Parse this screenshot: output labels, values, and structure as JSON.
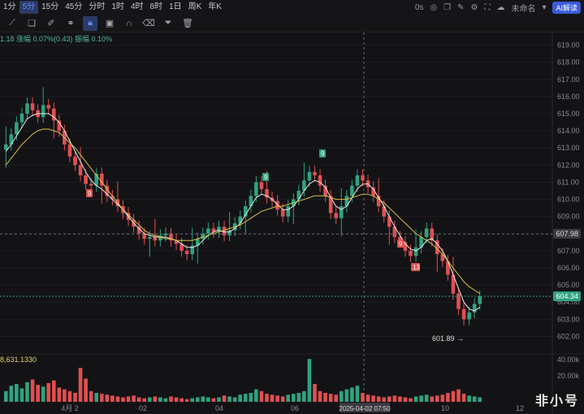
{
  "timeframes": [
    "1分",
    "5分",
    "15分",
    "45分",
    "分时",
    "1时",
    "4时",
    "8时",
    "1日",
    "周K",
    "年K"
  ],
  "active_timeframe": "5分",
  "top_right": {
    "countdown": "0s",
    "layout_name": "未命名",
    "ai_button": "AI解读"
  },
  "legend": {
    "ma_text": "1.18  涨幅 0.07%(0.43)  振幅 0.10%",
    "volume_text": "8,631.1330"
  },
  "price_axis": [
    "619.00",
    "618.00",
    "617.00",
    "616.00",
    "615.00",
    "614.00",
    "613.00",
    "612.00",
    "611.00",
    "610.00",
    "609.00",
    "608.00",
    "607.00",
    "606.00",
    "605.00",
    "604.00",
    "603.00",
    "602.00"
  ],
  "volume_axis": [
    "40.00k",
    "20.00k"
  ],
  "time_axis": [
    "4月 2",
    "02",
    "04",
    "06",
    "08",
    "10",
    "12"
  ],
  "crosshair": {
    "time_label": "2025-04-02 07:50",
    "price_label": "607.98"
  },
  "last_price": "604.34",
  "low_label": "601.89",
  "markers": [
    {
      "text": "9",
      "color": "#e05050"
    },
    {
      "text": "9",
      "color": "#2fa37f"
    },
    {
      "text": "9",
      "color": "#2fa37f"
    },
    {
      "text": "9",
      "color": "#e05050"
    },
    {
      "text": "13",
      "color": "#e05050"
    }
  ],
  "watermark": "非小号",
  "colors": {
    "up": "#2fa37f",
    "down": "#e05050",
    "ma1": "#e8e8e8",
    "ma2": "#d9c044"
  },
  "chart_data": {
    "type": "candlestick",
    "close_series": [
      613.2,
      613.8,
      614.5,
      615.0,
      615.6,
      615.2,
      614.8,
      615.5,
      615.3,
      614.6,
      614.0,
      613.2,
      612.5,
      612.0,
      611.4,
      610.9,
      610.8,
      611.5,
      610.8,
      610.2,
      610.0,
      609.6,
      609.2,
      608.8,
      608.4,
      608.0,
      607.7,
      607.8,
      607.6,
      607.9,
      608.0,
      607.6,
      607.4,
      607.0,
      606.8,
      607.3,
      607.7,
      608.0,
      608.3,
      608.1,
      608.4,
      607.9,
      608.2,
      608.6,
      609.0,
      609.6,
      610.2,
      611.0,
      610.6,
      610.1,
      609.9,
      609.4,
      609.0,
      609.6,
      610.0,
      610.5,
      611.1,
      611.6,
      611.4,
      610.8,
      610.2,
      609.2,
      608.9,
      609.6,
      610.2,
      610.8,
      611.4,
      611.1,
      610.7,
      610.2,
      609.6,
      609.0,
      608.4,
      607.8,
      607.5,
      607.0,
      606.7,
      607.2,
      607.8,
      608.3,
      607.6,
      606.8,
      606.4,
      605.6,
      604.5,
      603.6,
      603.0,
      603.4,
      603.9,
      604.34
    ],
    "ma_fast": [
      612.8,
      613.2,
      613.7,
      614.2,
      614.7,
      614.9,
      615.0,
      615.0,
      615.0,
      614.8,
      614.5,
      614.0,
      613.4,
      612.8,
      612.2,
      611.6,
      611.1,
      610.8,
      610.6,
      610.3,
      610.0,
      609.7,
      609.4,
      609.0,
      608.6,
      608.3,
      608.0,
      607.9,
      607.8,
      607.8,
      607.8,
      607.7,
      607.6,
      607.4,
      607.2,
      607.2,
      607.3,
      607.6,
      607.9,
      608.1,
      608.2,
      608.1,
      608.1,
      608.3,
      608.6,
      609.1,
      609.6,
      610.1,
      610.3,
      610.2,
      610.0,
      609.7,
      609.4,
      609.4,
      609.6,
      610.0,
      610.5,
      610.9,
      611.1,
      611.0,
      610.7,
      610.1,
      609.6,
      609.4,
      609.6,
      610.1,
      610.6,
      610.9,
      610.9,
      610.6,
      610.1,
      609.6,
      609.0,
      608.4,
      607.9,
      607.4,
      607.1,
      607.0,
      607.2,
      607.6,
      607.7,
      607.4,
      607.0,
      606.4,
      605.6,
      604.8,
      604.0,
      603.6,
      603.5,
      603.7
    ],
    "ma_slow": [
      612.0,
      612.4,
      612.8,
      613.2,
      613.5,
      613.8,
      614.0,
      614.1,
      614.1,
      614.0,
      613.9,
      613.6,
      613.3,
      613.0,
      612.6,
      612.2,
      611.8,
      611.4,
      611.0,
      610.6,
      610.2,
      609.8,
      609.4,
      609.1,
      608.8,
      608.5,
      608.2,
      608.0,
      607.9,
      607.8,
      607.7,
      607.7,
      607.6,
      607.6,
      607.6,
      607.6,
      607.7,
      607.8,
      607.9,
      608.0,
      608.1,
      608.2,
      608.3,
      608.4,
      608.5,
      608.7,
      608.9,
      609.1,
      609.3,
      609.4,
      609.5,
      609.6,
      609.6,
      609.7,
      609.8,
      609.9,
      610.0,
      610.1,
      610.2,
      610.2,
      610.2,
      610.1,
      610.0,
      610.0,
      610.0,
      610.1,
      610.2,
      610.3,
      610.3,
      610.2,
      610.0,
      609.8,
      609.5,
      609.2,
      608.9,
      608.6,
      608.3,
      608.0,
      607.8,
      607.6,
      607.4,
      607.1,
      606.8,
      606.4,
      606.0,
      605.6,
      605.2,
      604.9,
      604.7,
      604.5
    ],
    "volumes": [
      12,
      18,
      20,
      15,
      22,
      25,
      19,
      17,
      21,
      24,
      16,
      14,
      12,
      10,
      38,
      26,
      12,
      10,
      9,
      8,
      7,
      6,
      5,
      6,
      7,
      5,
      4,
      5,
      6,
      5,
      4,
      6,
      5,
      4,
      3,
      4,
      5,
      6,
      5,
      4,
      5,
      7,
      6,
      5,
      8,
      9,
      10,
      14,
      12,
      9,
      8,
      7,
      6,
      8,
      9,
      10,
      12,
      48,
      20,
      12,
      10,
      9,
      8,
      12,
      14,
      16,
      18,
      10,
      8,
      7,
      6,
      5,
      6,
      7,
      6,
      5,
      4,
      6,
      7,
      8,
      6,
      7,
      8,
      10,
      12,
      14,
      9,
      7,
      6,
      5
    ],
    "y_range": [
      601.5,
      619.5
    ]
  }
}
